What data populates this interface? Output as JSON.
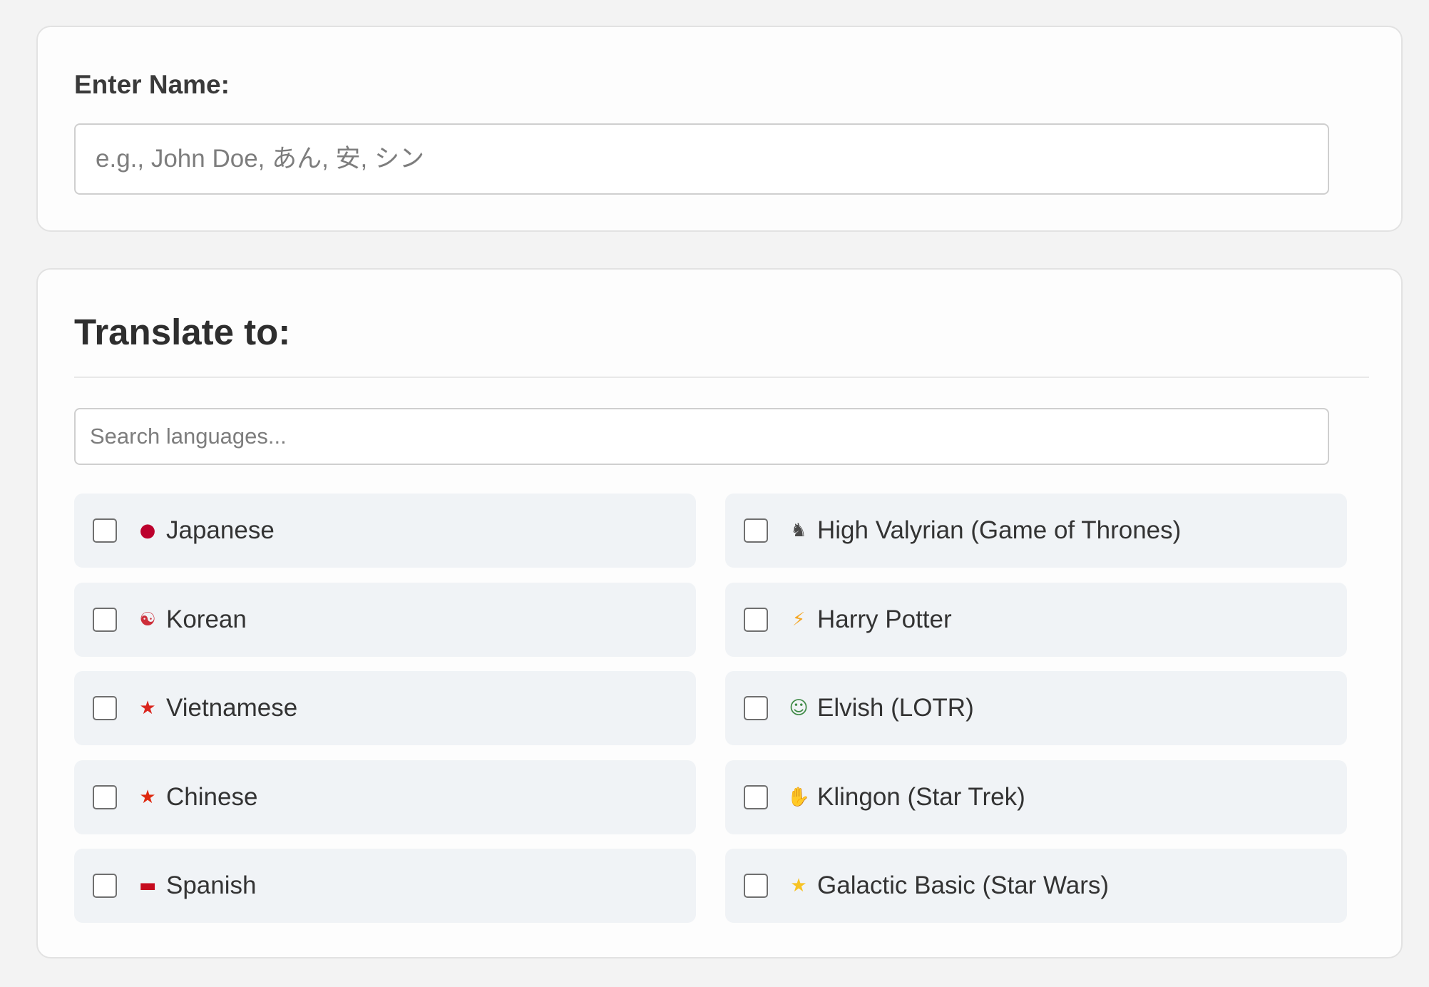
{
  "name_section": {
    "label": "Enter Name:",
    "input_value": "",
    "input_placeholder": "e.g., John Doe, あん, 安, シン"
  },
  "translate_section": {
    "title": "Translate to:",
    "search_placeholder": "Search languages...",
    "search_value": "",
    "languages": [
      {
        "icon": "japan-flag",
        "glyph": "●",
        "label": "Japanese",
        "checked": false
      },
      {
        "icon": "dragon",
        "glyph": "♞",
        "label": "High Valyrian (Game of Thrones)",
        "checked": false
      },
      {
        "icon": "south-korea-flag",
        "glyph": "☯",
        "label": "Korean",
        "checked": false
      },
      {
        "icon": "lightning-bolt",
        "glyph": "⚡",
        "label": "Harry Potter",
        "checked": false
      },
      {
        "icon": "vietnam-flag",
        "glyph": "★",
        "label": "Vietnamese",
        "checked": false
      },
      {
        "icon": "elf",
        "glyph": "☺",
        "label": "Elvish (LOTR)",
        "checked": false
      },
      {
        "icon": "china-flag",
        "glyph": "★",
        "label": "Chinese",
        "checked": false
      },
      {
        "icon": "vulcan-salute",
        "glyph": "✋",
        "label": "Klingon (Star Trek)",
        "checked": false
      },
      {
        "icon": "spain-flag",
        "glyph": "▬",
        "label": "Spanish",
        "checked": false
      },
      {
        "icon": "star",
        "glyph": "★",
        "label": "Galactic Basic (Star Wars)",
        "checked": false
      }
    ]
  },
  "colors": {
    "page_background": "#f3f3f3",
    "panel_background": "#fdfdfd",
    "item_background": "#f0f3f6",
    "text": "#333333",
    "japan-flag": "#bc002d",
    "dragon": "#4a4a4a",
    "south-korea-flag": "#cd2e3a",
    "lightning-bolt": "#f5a623",
    "vietnam-flag": "#da251d",
    "elf": "#3f8a46",
    "china-flag": "#de2910",
    "vulcan-salute": "#e8a33a",
    "spain-flag": "#c60b1e",
    "star": "#f7c325"
  }
}
